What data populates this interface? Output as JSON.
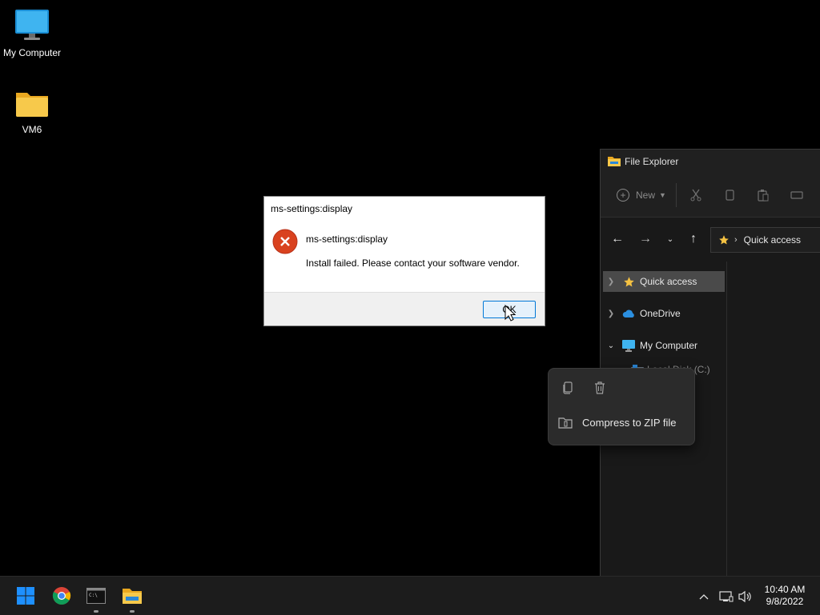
{
  "desktop": {
    "icons": [
      {
        "label": "My Computer",
        "icon": "monitor-icon"
      },
      {
        "label": "VM6",
        "icon": "folder-icon"
      }
    ]
  },
  "explorer": {
    "title": "File Explorer",
    "toolbar": {
      "new_label": "New"
    },
    "address": {
      "label": "Quick access"
    },
    "sidebar": {
      "items": [
        {
          "label": "Quick access",
          "icon": "star-icon",
          "selected": true
        },
        {
          "label": "OneDrive",
          "icon": "cloud-icon"
        },
        {
          "label": "My Computer",
          "icon": "monitor-icon",
          "expanded": true
        },
        {
          "label": "Local Disk (C:)",
          "icon": "drive-icon"
        }
      ]
    }
  },
  "dialog": {
    "title": "ms-settings:display",
    "heading": "ms-settings:display",
    "message": "Install failed. Please contact your software vendor.",
    "ok_label": "OK",
    "icon": "error-icon"
  },
  "context_menu": {
    "items": [
      {
        "label": "Compress to ZIP file",
        "icon": "zip-folder-icon"
      }
    ],
    "top_icons": [
      "copy-icon",
      "trash-icon"
    ]
  },
  "taskbar": {
    "apps": [
      "start-icon",
      "chrome-icon",
      "terminal-icon",
      "file-explorer-icon"
    ],
    "clock": {
      "time": "10:40 AM",
      "date": "9/8/2022"
    }
  },
  "colors": {
    "accent": "#0078d7",
    "error": "#d9421f",
    "folder": "#f5c242",
    "selection": "#4a4a4a"
  }
}
